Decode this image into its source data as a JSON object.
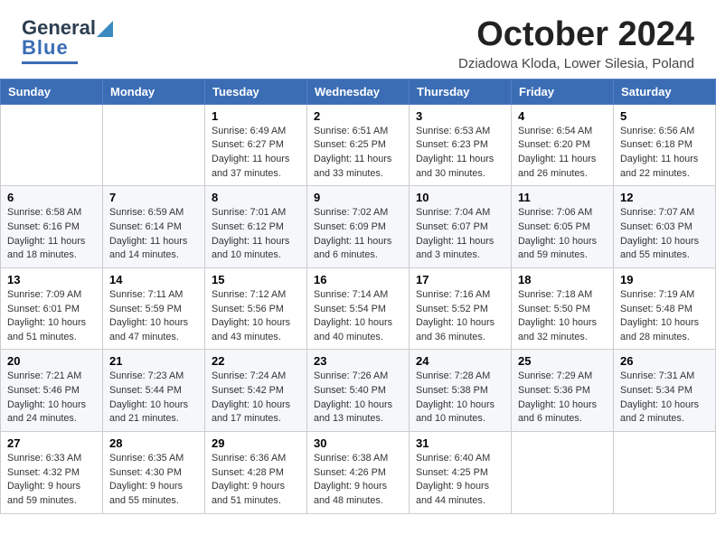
{
  "header": {
    "logo_general": "General",
    "logo_blue": "Blue",
    "month_title": "October 2024",
    "location": "Dziadowa Kloda, Lower Silesia, Poland"
  },
  "columns": [
    "Sunday",
    "Monday",
    "Tuesday",
    "Wednesday",
    "Thursday",
    "Friday",
    "Saturday"
  ],
  "weeks": [
    [
      {
        "day": "",
        "info": ""
      },
      {
        "day": "",
        "info": ""
      },
      {
        "day": "1",
        "info": "Sunrise: 6:49 AM\nSunset: 6:27 PM\nDaylight: 11 hours and 37 minutes."
      },
      {
        "day": "2",
        "info": "Sunrise: 6:51 AM\nSunset: 6:25 PM\nDaylight: 11 hours and 33 minutes."
      },
      {
        "day": "3",
        "info": "Sunrise: 6:53 AM\nSunset: 6:23 PM\nDaylight: 11 hours and 30 minutes."
      },
      {
        "day": "4",
        "info": "Sunrise: 6:54 AM\nSunset: 6:20 PM\nDaylight: 11 hours and 26 minutes."
      },
      {
        "day": "5",
        "info": "Sunrise: 6:56 AM\nSunset: 6:18 PM\nDaylight: 11 hours and 22 minutes."
      }
    ],
    [
      {
        "day": "6",
        "info": "Sunrise: 6:58 AM\nSunset: 6:16 PM\nDaylight: 11 hours and 18 minutes."
      },
      {
        "day": "7",
        "info": "Sunrise: 6:59 AM\nSunset: 6:14 PM\nDaylight: 11 hours and 14 minutes."
      },
      {
        "day": "8",
        "info": "Sunrise: 7:01 AM\nSunset: 6:12 PM\nDaylight: 11 hours and 10 minutes."
      },
      {
        "day": "9",
        "info": "Sunrise: 7:02 AM\nSunset: 6:09 PM\nDaylight: 11 hours and 6 minutes."
      },
      {
        "day": "10",
        "info": "Sunrise: 7:04 AM\nSunset: 6:07 PM\nDaylight: 11 hours and 3 minutes."
      },
      {
        "day": "11",
        "info": "Sunrise: 7:06 AM\nSunset: 6:05 PM\nDaylight: 10 hours and 59 minutes."
      },
      {
        "day": "12",
        "info": "Sunrise: 7:07 AM\nSunset: 6:03 PM\nDaylight: 10 hours and 55 minutes."
      }
    ],
    [
      {
        "day": "13",
        "info": "Sunrise: 7:09 AM\nSunset: 6:01 PM\nDaylight: 10 hours and 51 minutes."
      },
      {
        "day": "14",
        "info": "Sunrise: 7:11 AM\nSunset: 5:59 PM\nDaylight: 10 hours and 47 minutes."
      },
      {
        "day": "15",
        "info": "Sunrise: 7:12 AM\nSunset: 5:56 PM\nDaylight: 10 hours and 43 minutes."
      },
      {
        "day": "16",
        "info": "Sunrise: 7:14 AM\nSunset: 5:54 PM\nDaylight: 10 hours and 40 minutes."
      },
      {
        "day": "17",
        "info": "Sunrise: 7:16 AM\nSunset: 5:52 PM\nDaylight: 10 hours and 36 minutes."
      },
      {
        "day": "18",
        "info": "Sunrise: 7:18 AM\nSunset: 5:50 PM\nDaylight: 10 hours and 32 minutes."
      },
      {
        "day": "19",
        "info": "Sunrise: 7:19 AM\nSunset: 5:48 PM\nDaylight: 10 hours and 28 minutes."
      }
    ],
    [
      {
        "day": "20",
        "info": "Sunrise: 7:21 AM\nSunset: 5:46 PM\nDaylight: 10 hours and 24 minutes."
      },
      {
        "day": "21",
        "info": "Sunrise: 7:23 AM\nSunset: 5:44 PM\nDaylight: 10 hours and 21 minutes."
      },
      {
        "day": "22",
        "info": "Sunrise: 7:24 AM\nSunset: 5:42 PM\nDaylight: 10 hours and 17 minutes."
      },
      {
        "day": "23",
        "info": "Sunrise: 7:26 AM\nSunset: 5:40 PM\nDaylight: 10 hours and 13 minutes."
      },
      {
        "day": "24",
        "info": "Sunrise: 7:28 AM\nSunset: 5:38 PM\nDaylight: 10 hours and 10 minutes."
      },
      {
        "day": "25",
        "info": "Sunrise: 7:29 AM\nSunset: 5:36 PM\nDaylight: 10 hours and 6 minutes."
      },
      {
        "day": "26",
        "info": "Sunrise: 7:31 AM\nSunset: 5:34 PM\nDaylight: 10 hours and 2 minutes."
      }
    ],
    [
      {
        "day": "27",
        "info": "Sunrise: 6:33 AM\nSunset: 4:32 PM\nDaylight: 9 hours and 59 minutes."
      },
      {
        "day": "28",
        "info": "Sunrise: 6:35 AM\nSunset: 4:30 PM\nDaylight: 9 hours and 55 minutes."
      },
      {
        "day": "29",
        "info": "Sunrise: 6:36 AM\nSunset: 4:28 PM\nDaylight: 9 hours and 51 minutes."
      },
      {
        "day": "30",
        "info": "Sunrise: 6:38 AM\nSunset: 4:26 PM\nDaylight: 9 hours and 48 minutes."
      },
      {
        "day": "31",
        "info": "Sunrise: 6:40 AM\nSunset: 4:25 PM\nDaylight: 9 hours and 44 minutes."
      },
      {
        "day": "",
        "info": ""
      },
      {
        "day": "",
        "info": ""
      }
    ]
  ]
}
